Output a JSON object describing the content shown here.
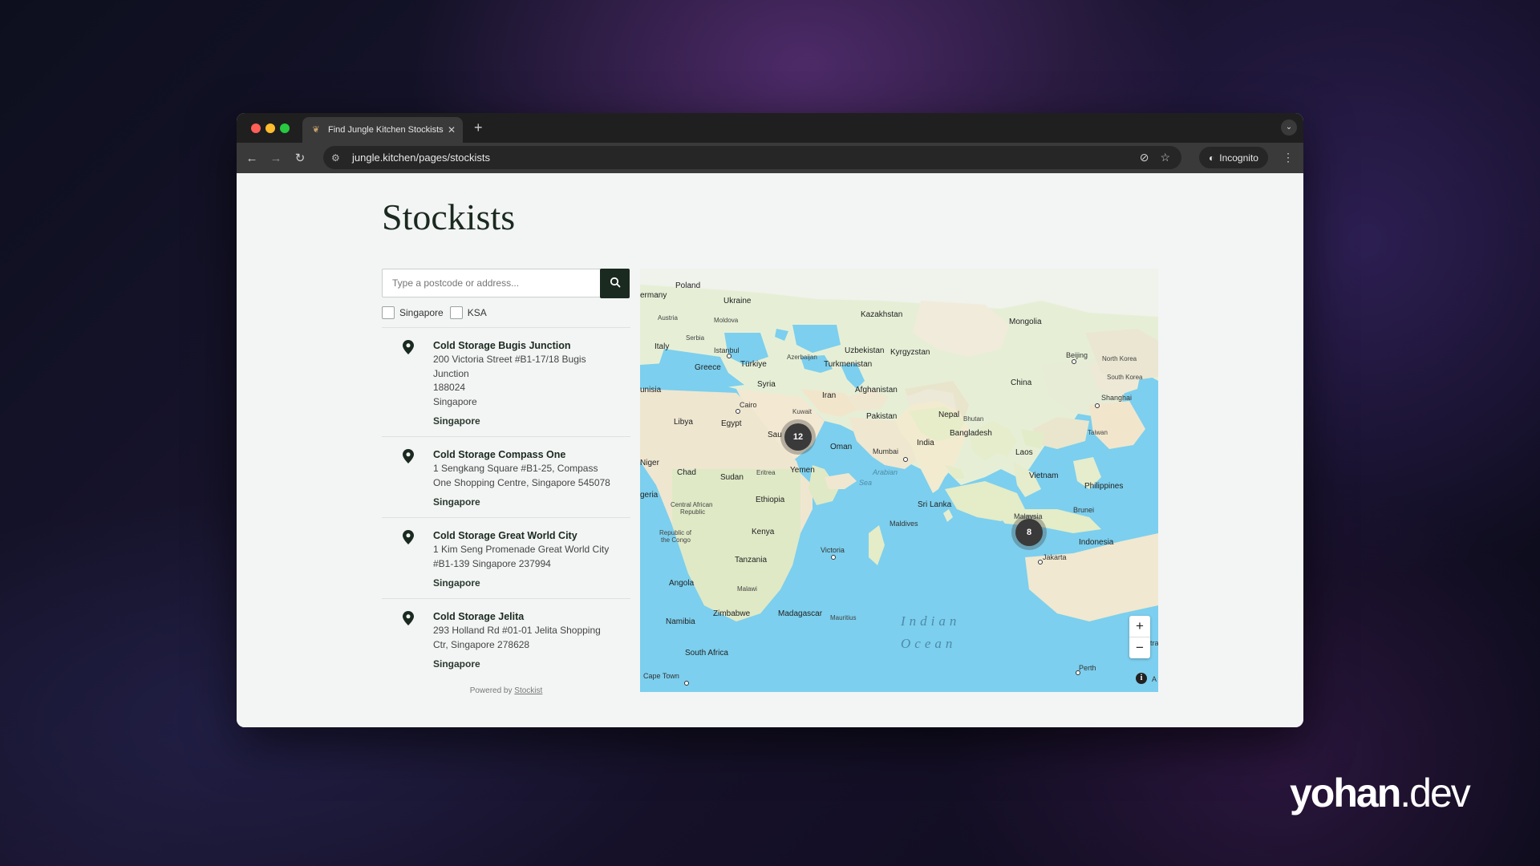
{
  "browser": {
    "tab_title": "Find Jungle Kitchen Stockists",
    "new_tab": "+",
    "url": "jungle.kitchen/pages/stockists",
    "incognito_label": "Incognito"
  },
  "page": {
    "title": "Stockists",
    "search_placeholder": "Type a postcode or address...",
    "filters": [
      {
        "label": "Singapore",
        "checked": false
      },
      {
        "label": "KSA",
        "checked": false
      }
    ],
    "stockists": [
      {
        "name": "Cold Storage Bugis Junction",
        "address_lines": [
          "200 Victoria Street #B1-17/18 Bugis",
          "Junction",
          "188024",
          "Singapore"
        ],
        "tag": "Singapore"
      },
      {
        "name": "Cold Storage Compass One",
        "address_lines": [
          "1 Sengkang Square #B1-25, Compass",
          "One Shopping Centre, Singapore 545078"
        ],
        "tag": "Singapore"
      },
      {
        "name": "Cold Storage Great World City",
        "address_lines": [
          "1 Kim Seng Promenade Great World City",
          "#B1-139 Singapore 237994"
        ],
        "tag": "Singapore"
      },
      {
        "name": "Cold Storage Jelita",
        "address_lines": [
          "293 Holland Rd #01-01 Jelita Shopping",
          "Ctr, Singapore 278628"
        ],
        "tag": "Singapore"
      }
    ],
    "powered_by": "Powered by",
    "powered_link": "Stockist"
  },
  "map": {
    "clusters": [
      {
        "count": "12"
      },
      {
        "count": "8"
      }
    ],
    "zoom_in": "+",
    "zoom_out": "−",
    "info": "i",
    "labels": {
      "poland": "Poland",
      "ukraine": "Ukraine",
      "germany": "ermany",
      "austria": "Austria",
      "moldova": "Moldova",
      "serbia": "Serbia",
      "italy": "Italy",
      "istanbul": "Istanbul",
      "greece": "Greece",
      "turkiye": "Türkiye",
      "azerbaijan": "Azerbaijan",
      "kazakhstan": "Kazakhstan",
      "mongolia": "Mongolia",
      "uzbekistan": "Uzbekistan",
      "kyrgyzstan": "Kyrgyzstan",
      "turkmenistan": "Turkmenistan",
      "beijing": "Beijing",
      "north_korea": "North Korea",
      "south_korea": "South Korea",
      "tunisia": "unisia",
      "syria": "Syria",
      "iran": "Iran",
      "afghanistan": "Afghanistan",
      "china": "China",
      "shanghai": "Shanghai",
      "cairo": "Cairo",
      "kuwait": "Kuwait",
      "libya": "Libya",
      "egypt": "Egypt",
      "pakistan": "Pakistan",
      "nepal": "Nepal",
      "bhutan": "Bhutan",
      "bangladesh": "Bangladesh",
      "taiwan": "Taiwan",
      "saudi": "Sau",
      "oman": "Oman",
      "india": "India",
      "mumbai": "Mumbai",
      "laos": "Laos",
      "niger": "Niger",
      "chad": "Chad",
      "sudan": "Sudan",
      "eritrea": "Eritrea",
      "yemen": "Yemen",
      "vietnam": "Vietnam",
      "philippines": "Philippines",
      "nigeria": "geria",
      "ethiopia": "Ethiopia",
      "sri_lanka": "Sri Lanka",
      "car": "Central African",
      "car2": "Republic",
      "brunei": "Brunei",
      "malaysia": "Malaysia",
      "maldives": "Maldives",
      "congo": "Republic of",
      "congo2": "the Congo",
      "kenya": "Kenya",
      "indonesia": "Indonesia",
      "victoria": "Victoria",
      "jakarta": "Jakarta",
      "tanzania": "Tanzania",
      "angola": "Angola",
      "malawi": "Malawi",
      "zimbabwe": "Zimbabwe",
      "madagascar": "Madagascar",
      "mauritius": "Mauritius",
      "namibia": "Namibia",
      "south_africa": "South Africa",
      "cape_town": "Cape Town",
      "perth": "Perth",
      "arabian": "Arabian",
      "sea": "Sea",
      "indian": "Indian",
      "ocean": "Ocean",
      "australia_cut": "tra",
      "australia_cut2": "A"
    }
  },
  "watermark": {
    "bold": "yohan",
    "light": ".dev"
  }
}
